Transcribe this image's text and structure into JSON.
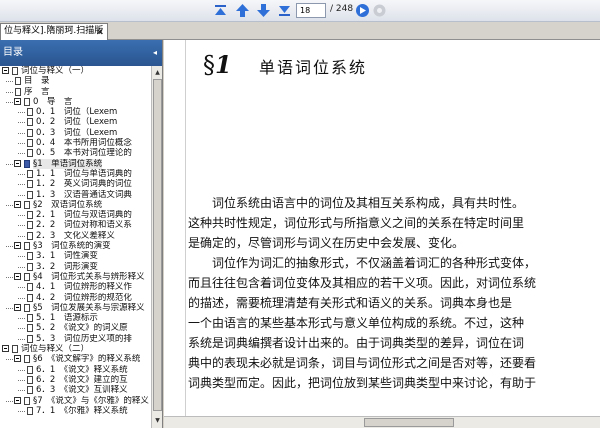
{
  "toolbar": {
    "page_current": "18",
    "page_total": "/ 248",
    "icons": [
      "first-page-icon",
      "prev-page-icon",
      "next-page-icon",
      "last-page-icon",
      "go-icon",
      "stop-icon"
    ]
  },
  "tab": {
    "title": "位与释义].隋丽珂.扫描版",
    "close": "✕"
  },
  "sidebar": {
    "title": "目录",
    "collapse": "◂",
    "items": [
      {
        "label": "词位与释义（一）"
      },
      {
        "label": "目　录"
      },
      {
        "label": "序　言"
      },
      {
        "label": "0　导　言"
      },
      {
        "label": "0．1　词位（Lexem"
      },
      {
        "label": "0．2　词位（Lexem"
      },
      {
        "label": "0．3　词位（Lexem"
      },
      {
        "label": "0．4　本书所用词位概念"
      },
      {
        "label": "0．5　本书对词位理论的"
      },
      {
        "label": "§1　单语词位系统"
      },
      {
        "label": "1．1　词位与单语词典的"
      },
      {
        "label": "1．2　英义词词典的词位"
      },
      {
        "label": "1．3　汉语普通话文词典"
      },
      {
        "label": "§2　双语词位系统"
      },
      {
        "label": "2．1　词位与双语词典的"
      },
      {
        "label": "2．2　词位对称和语义系"
      },
      {
        "label": "2．3　文化义差释义"
      },
      {
        "label": "§3　词位系统的演变"
      },
      {
        "label": "3．1　词性演变"
      },
      {
        "label": "3．2　词形演变"
      },
      {
        "label": "§4　词位形式关系与辨形释义"
      },
      {
        "label": "4．1　词位辨形的释义作"
      },
      {
        "label": "4．2　词位辨形的规范化"
      },
      {
        "label": "§5　词位发展关系与宗源释义"
      },
      {
        "label": "5．1　语源标示"
      },
      {
        "label": "5．2　《说文》的词义原"
      },
      {
        "label": "5．3　词位历史义项的排"
      },
      {
        "label": "词位与释义（二）"
      },
      {
        "label": "§6　《说文解字》的释义系统"
      },
      {
        "label": "6．1　《说文》释义系统"
      },
      {
        "label": "6．2　《说文》建立的互"
      },
      {
        "label": "6．3　《说文》互训释义"
      },
      {
        "label": "§7　《说文》与《尔雅》的释义"
      },
      {
        "label": "7．1　《尔雅》释义系统"
      }
    ]
  },
  "doc": {
    "section_symbol": "§",
    "section_number": "1",
    "section_title": "单语词位系统",
    "paragraphs": [
      [
        "词位系统由语言中的词位及其相互关系构成，具有共时性。",
        "这种共时性规定，词位形式与所指意义之间的关系在特定时间里",
        "是确定的，尽管词形与词义在历史中会发展、变化。"
      ],
      [
        "词位作为词汇的抽象形式，不仅涵盖着词汇的各种形式变体，",
        "而且往往包含着词位变体及其相应的若干义项。因此，对词位系统",
        "的描述，需要梳理清楚有关形式和语义的关系。词典本身也是",
        "一个由语言的某些基本形式与意义单位构成的系统。不过，这种",
        "系统是词典编撰者设计出来的。由于词典类型的差异，词位在词",
        "典中的表现未必就是词条，词目与词位形式之间是否对等，还要看",
        "词典类型而定。因此，把词位放到某些词典类型中来讨论，有助于"
      ]
    ]
  }
}
